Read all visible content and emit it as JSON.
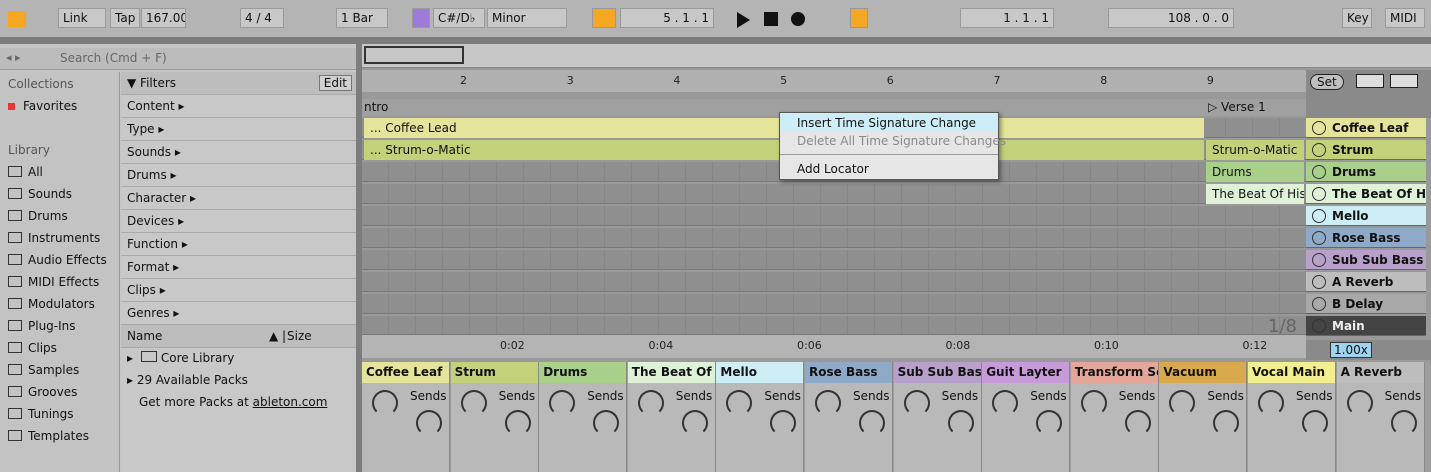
{
  "transport": {
    "link": "Link",
    "tap": "Tap",
    "tempo": "167.00",
    "sig": "4 / 4",
    "quant": "1 Bar",
    "key": "C#/D♭",
    "scale": "Minor",
    "pos": "5 .  1 .  1",
    "loop_start": "1 .  1 .  1",
    "loop_len": "108 .  0 .  0",
    "key_label": "Key",
    "midi_label": "MIDI"
  },
  "browser": {
    "search_placeholder": "Search (Cmd + F)",
    "collections": "Collections",
    "favorites": "Favorites",
    "library": "Library",
    "library_items": [
      "All",
      "Sounds",
      "Drums",
      "Instruments",
      "Audio Effects",
      "MIDI Effects",
      "Modulators",
      "Plug-Ins",
      "Clips",
      "Samples",
      "Grooves",
      "Tunings",
      "Templates"
    ],
    "filters": "Filters",
    "edit": "Edit",
    "filter_rows": [
      "Content ▸",
      "Type ▸",
      "Sounds ▸",
      "Drums ▸",
      "Character ▸",
      "Devices ▸",
      "Function ▸",
      "Format ▸",
      "Clips ▸",
      "Genres ▸"
    ],
    "name_header": "Name",
    "size_header": "Size",
    "core_library": "Core Library",
    "packs": "29 Available Packs",
    "get_more": "Get more Packs at ",
    "get_more_link": "ableton.com"
  },
  "arrangement": {
    "bars": [
      "2",
      "3",
      "4",
      "5",
      "6",
      "7",
      "8",
      "9"
    ],
    "intro": "ntro",
    "verse": "Verse 1",
    "clip1": "... Coffee Lead",
    "clip2": "... Strum-o-Matic",
    "session_clips": [
      "Strum-o-Matic",
      "Drums",
      "The Beat Of Histo"
    ],
    "times": [
      "0:02",
      "0:04",
      "0:06",
      "0:08",
      "0:10",
      "0:12"
    ],
    "zoom_frac": "1/8",
    "set_btn": "Set",
    "zoom": "1.00x"
  },
  "tracks": [
    "Coffee Leaf",
    "Strum",
    "Drums",
    "The Beat Of His",
    "Mello",
    "Rose Bass",
    "Sub Sub Bass",
    "A Reverb",
    "B Delay",
    "Main"
  ],
  "menu": {
    "insert": "Insert Time Signature Change",
    "delete": "Delete All Time Signature Changes",
    "add_locator": "Add Locator"
  },
  "mixer": {
    "strips": [
      "Coffee Leaf",
      "Strum",
      "Drums",
      "The Beat Of H",
      "Mello",
      "Rose Bass",
      "Sub Sub Bass",
      "Guit Layter",
      "Transform Se",
      "Vacuum",
      "Vocal Main",
      "A Reverb"
    ],
    "sends": "Sends"
  },
  "colors": {
    "accent": "#f5a623",
    "clip_yellow": "#e4e49a",
    "clip_green": "#c3d27a",
    "drums": "#a8d08a",
    "mello": "#cdeef5",
    "rose": "#8fa9c8",
    "subsub": "#b7a0c9",
    "guit": "#c79ad8",
    "transform": "#e3a79a",
    "vacuum": "#d9a94e",
    "vocal": "#f2ef91"
  }
}
